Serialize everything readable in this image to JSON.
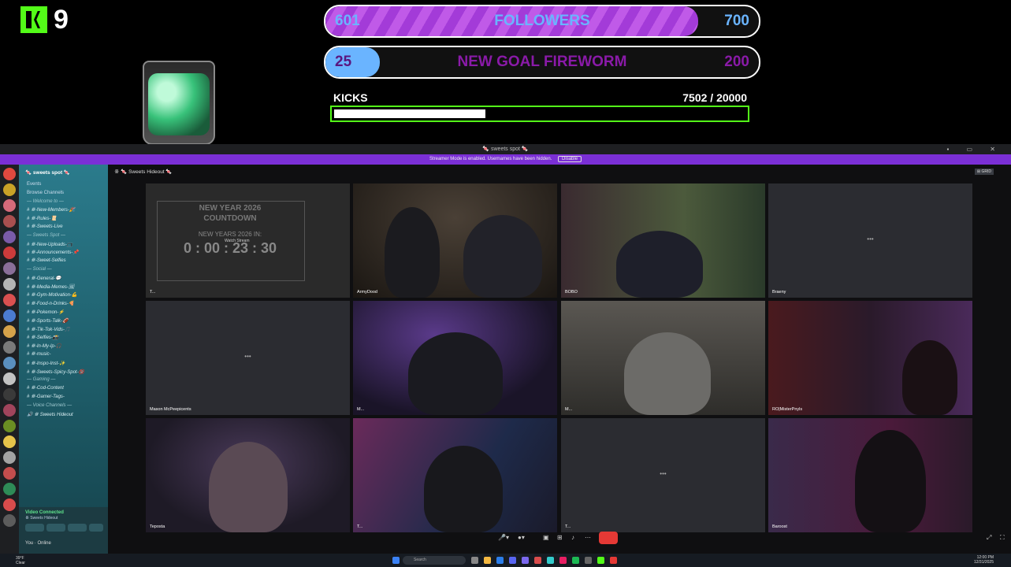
{
  "overlay": {
    "kick_count": "9",
    "followers_goal": {
      "current": "601",
      "label": "FOLLOWERS",
      "target": "700",
      "fraction": 0.86
    },
    "fireworm_goal": {
      "current": "25",
      "label": "NEW GOAL FIREWORM",
      "target": "200",
      "fraction": 0.125
    },
    "kicks": {
      "label": "KICKS",
      "value": "7502  / 20000",
      "fraction": 0.375
    }
  },
  "window": {
    "title": "🍬 sweets spot 🍬",
    "banner_text": "Streamer Mode is enabled. Usernames have been hidden.",
    "banner_button": "Disable",
    "window_controls": "▪ ▭ ✕"
  },
  "sidebar": {
    "server_name": "🍬 sweets spot 🍬",
    "items": [
      "Events",
      "Browse Channels",
      "— Welcome to —",
      "# ꗥ-New-Members-🎉",
      "# ꗥ-Rules-📜",
      "# ꗥ-Sweets-Live",
      "— Sweets Spot —",
      "# ꗥ-New-Uploads-📺",
      "# ꗥ-Announcements-📌",
      "# ꗥ-Sweet-Selfies",
      "— Social —",
      "# ꗥ-General-💬",
      "# ꗥ-Media-Memes-🖼",
      "# ꗥ-Gym-Motivation-💪",
      "# ꗥ-Food-n-Drinks-🍕",
      "# ꗥ-Pokemon-⚡",
      "# ꗥ-Sports-Talk-🏈",
      "# ꗥ-Tik-Tok-Vids-🎵",
      "# ꗥ-Selfies-📸",
      "# ꗥ-In-My-Ip-🎧",
      "# ꗥ-music-",
      "# ꗥ-Inspo-Inst-✨",
      "# ꗥ-Sweets-Spicy-Spot-🔞",
      "— Gaming —",
      "# ꗥ-Cod-Content",
      "# ꗥ-Gamer-Tags-",
      "— Voice Channels —",
      "🔊 ꗥ Sweets Hideout"
    ]
  },
  "voice": {
    "status": "Video Connected",
    "sub": "ꗥ Sweets Hideout",
    "user": "You",
    "user_sub": "Online"
  },
  "main": {
    "header": "ꗥ 🍬 Sweets Hideout 🍬",
    "grid_label": "⊞ GRID",
    "countdown": {
      "title": "NEW YEAR 2026\nCOUNTDOWN",
      "sub": "NEW YEARS 2026 IN:",
      "time": "0 : 00 : 23 : 30",
      "stream_label": "Watch Stream"
    },
    "tiles": [
      {
        "name": "T..."
      },
      {
        "name": "ArmyDood"
      },
      {
        "name": "BOBO"
      },
      {
        "name": "Braeny"
      },
      {
        "name": "Mason McPeepicents"
      },
      {
        "name": "M..."
      },
      {
        "name": "M..."
      },
      {
        "name": "RO|MisterPnyls"
      },
      {
        "name": "Teposta"
      },
      {
        "name": "T..."
      },
      {
        "name": "T..."
      },
      {
        "name": "Baroost"
      }
    ],
    "loading_dots": "•••"
  },
  "taskbar": {
    "search": "Search",
    "clock_time": "12:00 PM",
    "clock_date": "12/31/2025",
    "weather": "39°F\nClear"
  },
  "colors": {
    "kick_green": "#53fc18",
    "followers_fill": "#a33bd8",
    "followers_text": "#6ab4ff",
    "fireworm_text": "#8a1aa8",
    "discord_purple": "#7b2fd6",
    "active_tile": "#3fb950",
    "hangup": "#e53935"
  }
}
